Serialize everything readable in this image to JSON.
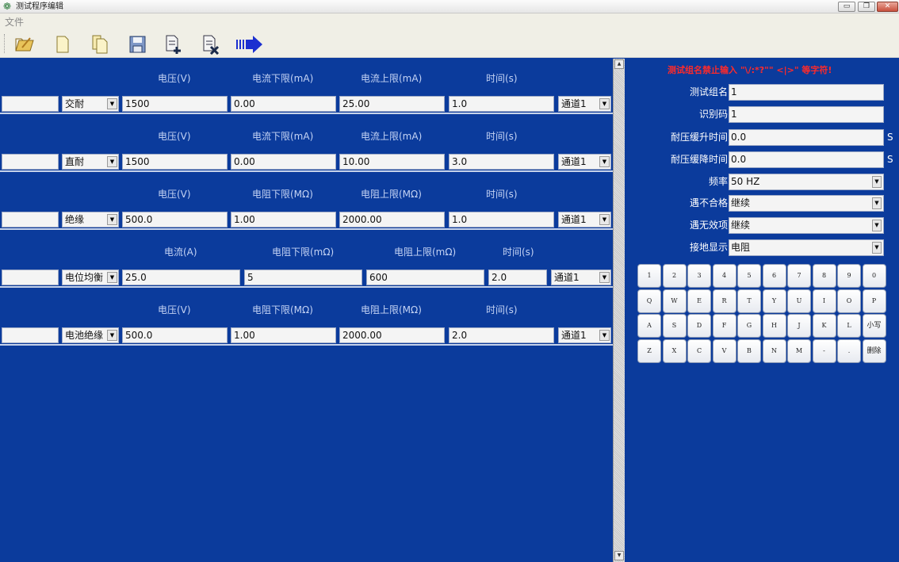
{
  "window": {
    "title": "测试程序编辑",
    "minimize_glyph": "▭",
    "restore_glyph": "❐",
    "close_glyph": "✕"
  },
  "menu": {
    "file": "文件"
  },
  "toolbar": {
    "icons": [
      "open-folder-icon",
      "new-file-icon",
      "copy-file-icon",
      "save-icon",
      "add-document-icon",
      "delete-document-icon",
      "run-arrow-icon"
    ]
  },
  "colors": {
    "panel_bg": "#0b3b9c",
    "warning": "#ff2a2a",
    "header_text": "#c4d3f4"
  },
  "rows": [
    {
      "headers": [
        "电压(V)",
        "电流下限(mA)",
        "电流上限(mA)",
        "时间(s)"
      ],
      "name": "",
      "type": "交耐",
      "values": [
        "1500",
        "0.00",
        "25.00",
        "1.0"
      ],
      "channel": "通道1"
    },
    {
      "headers": [
        "电压(V)",
        "电流下限(mA)",
        "电流上限(mA)",
        "时间(s)"
      ],
      "name": "",
      "type": "直耐",
      "values": [
        "1500",
        "0.00",
        "10.00",
        "3.0"
      ],
      "channel": "通道1"
    },
    {
      "headers": [
        "电压(V)",
        "电阻下限(MΩ)",
        "电阻上限(MΩ)",
        "时间(s)"
      ],
      "name": "",
      "type": "绝缘",
      "values": [
        "500.0",
        "1.00",
        "2000.00",
        "1.0"
      ],
      "channel": "通道1"
    },
    {
      "headers": [
        "电流(A)",
        "电阻下限(mΩ)",
        "电阻上限(mΩ)",
        "时间(s)"
      ],
      "name": "",
      "type": "电位均衡",
      "values": [
        "25.0",
        "5",
        "600",
        "2.0"
      ],
      "channel": "通道1"
    },
    {
      "headers": [
        "电压(V)",
        "电阻下限(MΩ)",
        "电阻上限(MΩ)",
        "时间(s)"
      ],
      "name": "",
      "type": "电池绝缘",
      "values": [
        "500.0",
        "1.00",
        "2000.00",
        "2.0"
      ],
      "channel": "通道1"
    }
  ],
  "settings": {
    "warning": "测试组名禁止输入 \"\\/:*?\"\" <|>\" 等字符!",
    "fields": [
      {
        "label": "测试组名",
        "value": "1",
        "unit": ""
      },
      {
        "label": "识别码",
        "value": "1",
        "unit": ""
      },
      {
        "label": "耐压缓升时间",
        "value": "0.0",
        "unit": "S"
      },
      {
        "label": "耐压缓降时间",
        "value": "0.0",
        "unit": "S"
      },
      {
        "label": "频率",
        "value": "50 HZ",
        "unit": ""
      },
      {
        "label": "遇不合格",
        "value": "继续",
        "unit": ""
      },
      {
        "label": "遇无效项",
        "value": "继续",
        "unit": ""
      },
      {
        "label": "接地显示",
        "value": "电阻",
        "unit": ""
      }
    ]
  },
  "keypad": {
    "rows": [
      [
        "1",
        "2",
        "3",
        "4",
        "5",
        "6",
        "7",
        "8",
        "9",
        "0"
      ],
      [
        "Q",
        "W",
        "E",
        "R",
        "T",
        "Y",
        "U",
        "I",
        "O",
        "P"
      ],
      [
        "A",
        "S",
        "D",
        "F",
        "G",
        "H",
        "J",
        "K",
        "L",
        "小写"
      ],
      [
        "Z",
        "X",
        "C",
        "V",
        "B",
        "N",
        "M",
        "-",
        ".",
        "删除"
      ]
    ]
  }
}
